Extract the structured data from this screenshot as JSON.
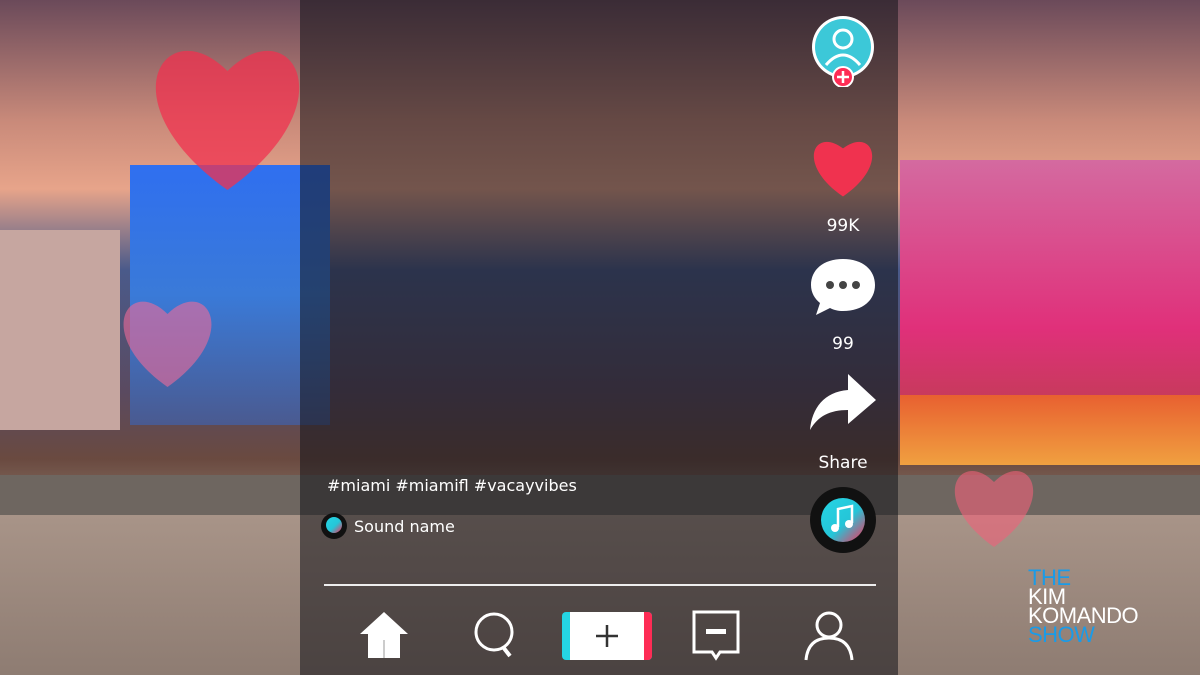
{
  "caption": {
    "hashtags": "#miami #miamifl #vacayvibes",
    "sound": "Sound name"
  },
  "actions": {
    "likes": "99K",
    "comments": "99",
    "share": "Share"
  },
  "nav": [
    {
      "icon": "home-icon"
    },
    {
      "icon": "search-icon"
    },
    {
      "icon": "plus-icon"
    },
    {
      "icon": "inbox-icon"
    },
    {
      "icon": "profile-icon"
    }
  ],
  "logo": {
    "line1": "THE",
    "line2": "KIM",
    "line3": "KOMANDO",
    "line4": "SHOW"
  },
  "colors": {
    "heart": "#f0324f",
    "cyan": "#25d5e4",
    "pink": "#fe2c55",
    "logo_blue": "#1a9be8"
  }
}
